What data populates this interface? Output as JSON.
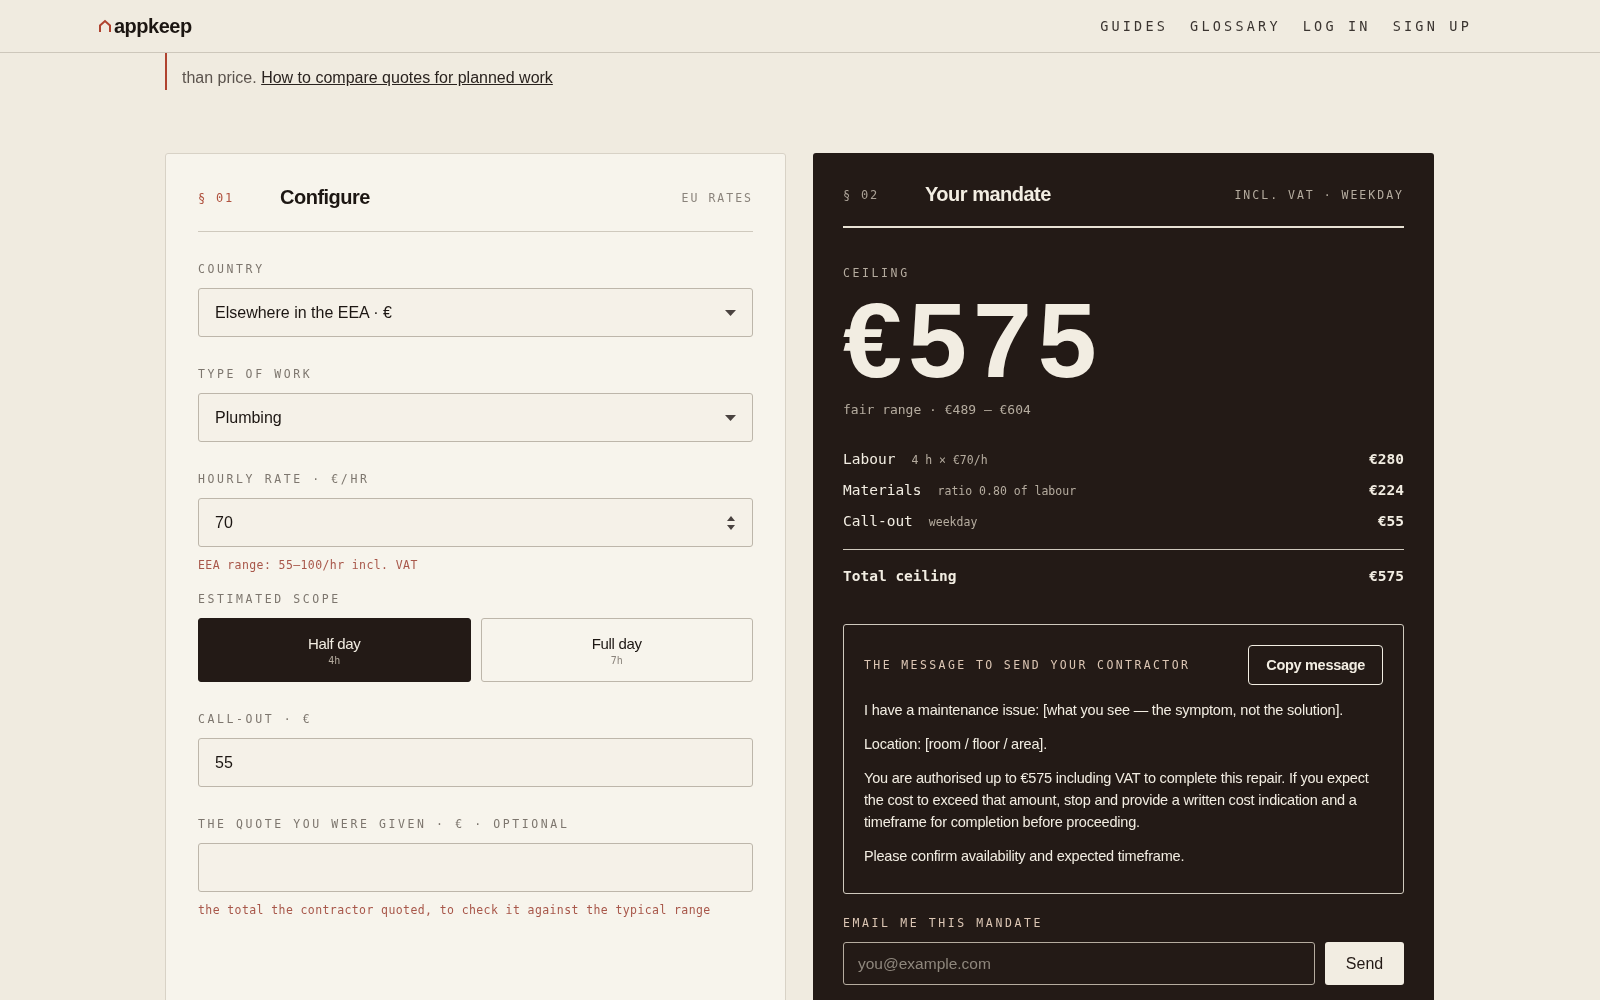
{
  "header": {
    "logo": "appkeep",
    "nav": [
      "GUIDES",
      "GLOSSARY",
      "LOG IN",
      "SIGN UP"
    ]
  },
  "intro": {
    "text": "than price.",
    "link": "How to compare quotes for planned work"
  },
  "configure": {
    "section": "§ 01",
    "title": "Configure",
    "tag": "EU RATES",
    "fields": [
      {
        "kind": "select",
        "label": "COUNTRY",
        "value": "Elsewhere in the EEA · €"
      },
      {
        "kind": "select",
        "label": "TYPE OF WORK",
        "value": "Plumbing"
      },
      {
        "kind": "number",
        "label": "HOURLY RATE · €/HR",
        "value": "70",
        "hint": "EEA range: 55–100/hr incl. VAT"
      },
      {
        "kind": "segmented",
        "label": "ESTIMATED SCOPE",
        "options": [
          {
            "label": "Half day",
            "sub": "4h",
            "selected": true
          },
          {
            "label": "Full day",
            "sub": "7h",
            "selected": false
          }
        ]
      },
      {
        "kind": "text",
        "label": "CALL-OUT · €",
        "value": "55"
      },
      {
        "kind": "text",
        "label": "THE QUOTE YOU WERE GIVEN · € · OPTIONAL",
        "hint": "the total the contractor quoted, to check it against the typical range"
      }
    ]
  },
  "mandate": {
    "section": "§ 02",
    "title": "Your mandate",
    "tag": "INCL. VAT · WEEKDAY",
    "ceiling_label": "CEILING",
    "ceiling": "€575",
    "fair_range": "fair range · €489 – €604",
    "lines": [
      {
        "label": "Labour",
        "detail": "4 h × €70/h",
        "amount": "€280"
      },
      {
        "label": "Materials",
        "detail": "ratio 0.80 of labour",
        "amount": "€224"
      },
      {
        "label": "Call-out",
        "detail": "weekday",
        "amount": "€55"
      }
    ],
    "total": {
      "label": "Total ceiling",
      "amount": "€575"
    },
    "message": {
      "title": "THE MESSAGE TO SEND YOUR CONTRACTOR",
      "button": "Copy message",
      "paragraphs": [
        "I have a maintenance issue: [what you see — the symptom, not the solution].",
        "Location: [room / floor / area].",
        "You are authorised up to €575 including VAT to complete this repair. If you expect the cost to exceed that amount, stop and provide a written cost indication and a timeframe for completion before proceeding.",
        "Please confirm availability and expected timeframe."
      ]
    },
    "email": {
      "label": "EMAIL ME THIS MANDATE",
      "placeholder": "you@example.com",
      "button": "Send"
    }
  }
}
